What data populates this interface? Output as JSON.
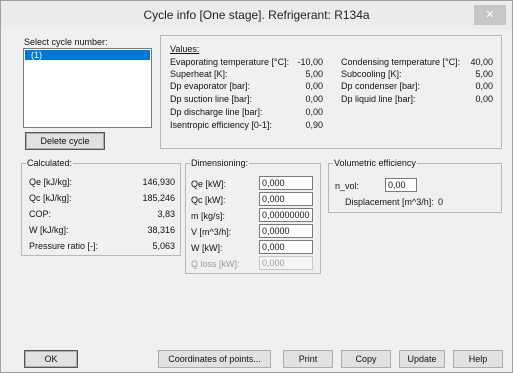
{
  "window": {
    "title": "Cycle info [One stage]. Refrigerant: R134a",
    "close_symbol": "✕"
  },
  "cycle_select": {
    "label": "Select cycle number:",
    "items": [
      "(1)"
    ],
    "delete_button": "Delete cycle"
  },
  "values": {
    "heading": "Values:",
    "left": [
      {
        "label": "Evaporating temperature [°C]:",
        "value": "-10,00"
      },
      {
        "label": "Superheat [K]:",
        "value": "5,00"
      },
      {
        "label": "Dp evaporator [bar]:",
        "value": "0,00"
      },
      {
        "label": "Dp suction line [bar]:",
        "value": "0,00"
      },
      {
        "label": "Dp discharge line [bar]:",
        "value": "0,00"
      },
      {
        "label": "Isentropic efficiency [0-1]:",
        "value": "0,90"
      }
    ],
    "right": [
      {
        "label": "Condensing temperature [°C]:",
        "value": "40,00"
      },
      {
        "label": "Subcooling [K]:",
        "value": "5,00"
      },
      {
        "label": "Dp condenser [bar]:",
        "value": "0,00"
      },
      {
        "label": "Dp liquid line [bar]:",
        "value": "0,00"
      }
    ]
  },
  "calculated": {
    "title": "Calculated:",
    "rows": [
      {
        "label": "Qe [kJ/kg]:",
        "value": "146,930"
      },
      {
        "label": "Qc [kJ/kg]:",
        "value": "185,246"
      },
      {
        "label": "COP:",
        "value": "3,83"
      },
      {
        "label": "W [kJ/kg]:",
        "value": "38,316"
      },
      {
        "label": "Pressure ratio [-]:",
        "value": "5,063"
      }
    ]
  },
  "dimensioning": {
    "title": "Dimensioning:",
    "rows": [
      {
        "label": "Qe [kW]:",
        "value": "0,000"
      },
      {
        "label": "Qc [kW]:",
        "value": "0,000"
      },
      {
        "label": "m [kg/s]:",
        "value": "0,00000000"
      },
      {
        "label": "V [m^3/h]:",
        "value": "0,0000"
      },
      {
        "label": "W [kW]:",
        "value": "0,000"
      },
      {
        "label": "Q loss [kW]:",
        "value": "0,000"
      }
    ]
  },
  "volumetric": {
    "title": "Volumetric efficiency",
    "n_vol_label": "n_vol:",
    "n_vol_value": "0,00",
    "displacement_label": "Displacement [m^3/h]:",
    "displacement_value": "0"
  },
  "buttons": {
    "ok": "OK",
    "coordinates": "Coordinates of points...",
    "print": "Print",
    "copy": "Copy",
    "update": "Update",
    "help": "Help"
  }
}
